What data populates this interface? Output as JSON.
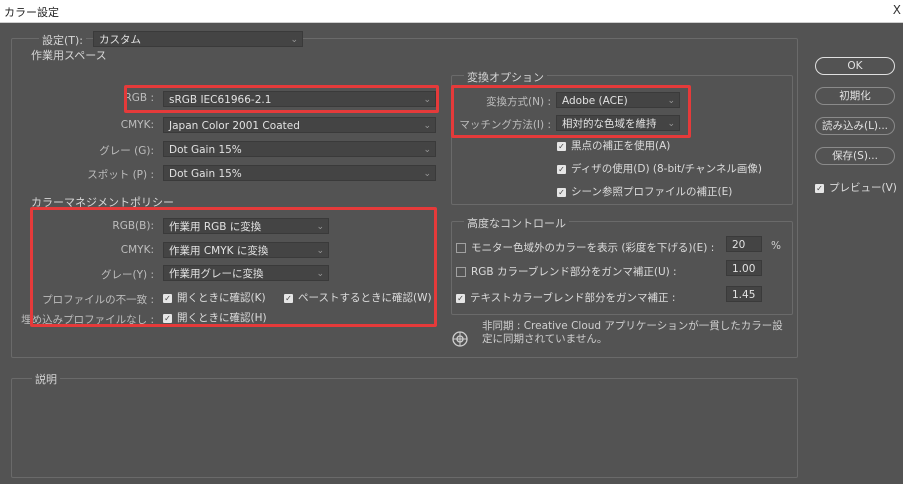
{
  "window": {
    "title": "カラー設定",
    "close": "X"
  },
  "settings": {
    "label": "設定(T):",
    "value": "カスタム"
  },
  "working_spaces": {
    "legend": "作業用スペース",
    "rgb": {
      "label": "RGB :",
      "value": "sRGB IEC61966-2.1"
    },
    "cmyk": {
      "label": "CMYK:",
      "value": "Japan Color 2001 Coated"
    },
    "gray": {
      "label": "グレー (G):",
      "value": "Dot Gain 15%"
    },
    "spot": {
      "label": "スポット (P) :",
      "value": "Dot Gain 15%"
    }
  },
  "policies": {
    "legend": "カラーマネジメントポリシー",
    "rgb": {
      "label": "RGB(B):",
      "value": "作業用 RGB に変換"
    },
    "cmyk": {
      "label": "CMYK:",
      "value": "作業用 CMYK に変換"
    },
    "gray": {
      "label": "グレー(Y) :",
      "value": "作業用グレーに変換"
    },
    "mismatch": {
      "label": "プロファイルの不一致 :",
      "open": "開くときに確認(K)",
      "paste": "ペーストするときに確認(W)"
    },
    "missing": {
      "label": "埋め込みプロファイルなし :",
      "open": "開くときに確認(H)"
    }
  },
  "conversion": {
    "legend": "変換オプション",
    "engine": {
      "label": "変換方式(N) :",
      "value": "Adobe (ACE)"
    },
    "intent": {
      "label": "マッチング方法(I) :",
      "value": "相対的な色域を維持"
    },
    "bpc": "黒点の補正を使用(A)",
    "dither": "ディザの使用(D) (8-bit/チャンネル画像)",
    "scene": "シーン参照プロファイルの補正(E)"
  },
  "advanced": {
    "legend": "高度なコントロール",
    "desaturate": {
      "label": "モニター色域外のカラーを表示 (彩度を下げる)(E) :",
      "value": "20",
      "unit": "%"
    },
    "rgb_blend": {
      "label": "RGB カラーブレンド部分をガンマ補正(U) :",
      "value": "1.00"
    },
    "text_blend": {
      "label": "テキストカラーブレンド部分をガンマ補正 :",
      "value": "1.45"
    }
  },
  "sync": {
    "text": "非同期 : Creative Cloud アプリケーションが一貫したカラー設定に同期されていません。"
  },
  "description": {
    "legend": "説明"
  },
  "buttons": {
    "ok": "OK",
    "reset": "初期化",
    "load": "読み込み(L)...",
    "save": "保存(S)...",
    "preview": "プレビュー(V)"
  },
  "colors": {
    "highlight": "#e53a3a",
    "background": "#535353",
    "field": "#444444"
  }
}
